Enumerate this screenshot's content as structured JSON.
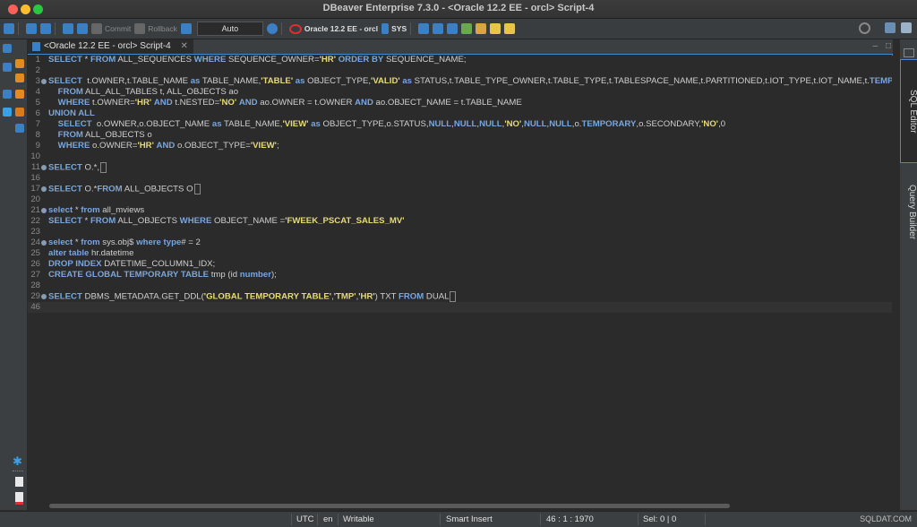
{
  "window": {
    "title": "DBeaver Enterprise 7.3.0 - <Oracle 12.2 EE - orcl> Script-4"
  },
  "toolbar": {
    "commit_label": "Commit",
    "rollback_label": "Rollback",
    "transaction_mode": "Auto",
    "connection_label": "Oracle 12.2 EE - orcl",
    "schema_label": "SYS"
  },
  "tab": {
    "label": "<Oracle 12.2 EE - orcl> Script-4"
  },
  "right_panel": {
    "sql_editor": "SQL Editor",
    "query_builder": "Query Builder"
  },
  "editor": {
    "lines": [
      {
        "n": "1",
        "fold": false,
        "tokens": [
          [
            "kw",
            "SELECT"
          ],
          [
            "p",
            " * "
          ],
          [
            "kw",
            "FROM"
          ],
          [
            "p",
            " ALL_SEQUENCES "
          ],
          [
            "kw",
            "WHERE"
          ],
          [
            "p",
            " SEQUENCE_OWNER="
          ],
          [
            "str",
            "'HR'"
          ],
          [
            "p",
            " "
          ],
          [
            "kw",
            "ORDER BY"
          ],
          [
            "p",
            " SEQUENCE_NAME;"
          ]
        ]
      },
      {
        "n": "2",
        "fold": false,
        "tokens": []
      },
      {
        "n": "3",
        "fold": true,
        "tokens": [
          [
            "kw",
            "SELECT"
          ],
          [
            "p",
            "  t.OWNER,t.TABLE_NAME "
          ],
          [
            "kw",
            "as"
          ],
          [
            "p",
            " TABLE_NAME,"
          ],
          [
            "str",
            "'TABLE'"
          ],
          [
            "p",
            " "
          ],
          [
            "kw",
            "as"
          ],
          [
            "p",
            " OBJECT_TYPE,"
          ],
          [
            "str",
            "'VALID'"
          ],
          [
            "p",
            " "
          ],
          [
            "kw",
            "as"
          ],
          [
            "p",
            " STATUS,t.TABLE_TYPE_OWNER,t.TABLE_TYPE,t.TABLESPACE_NAME,t.PARTITIONED,t.IOT_TYPE,t.IOT_NAME,t."
          ],
          [
            "kw",
            "TEMPO"
          ]
        ]
      },
      {
        "n": "4",
        "fold": false,
        "tokens": [
          [
            "p",
            "    "
          ],
          [
            "kw",
            "FROM"
          ],
          [
            "p",
            " ALL_ALL_TABLES t, ALL_OBJECTS ao"
          ]
        ]
      },
      {
        "n": "5",
        "fold": false,
        "tokens": [
          [
            "p",
            "    "
          ],
          [
            "kw",
            "WHERE"
          ],
          [
            "p",
            " t.OWNER="
          ],
          [
            "str",
            "'HR'"
          ],
          [
            "p",
            " "
          ],
          [
            "kw",
            "AND"
          ],
          [
            "p",
            " t.NESTED="
          ],
          [
            "str",
            "'NO'"
          ],
          [
            "p",
            " "
          ],
          [
            "kw",
            "AND"
          ],
          [
            "p",
            " ao.OWNER = t.OWNER "
          ],
          [
            "kw",
            "AND"
          ],
          [
            "p",
            " ao.OBJECT_NAME = t.TABLE_NAME"
          ]
        ]
      },
      {
        "n": "6",
        "fold": false,
        "tokens": [
          [
            "kw",
            "UNION ALL"
          ]
        ]
      },
      {
        "n": "7",
        "fold": false,
        "tokens": [
          [
            "p",
            "    "
          ],
          [
            "kw",
            "SELECT"
          ],
          [
            "p",
            "  o.OWNER,o.OBJECT_NAME "
          ],
          [
            "kw",
            "as"
          ],
          [
            "p",
            " TABLE_NAME,"
          ],
          [
            "str",
            "'VIEW'"
          ],
          [
            "p",
            " "
          ],
          [
            "kw",
            "as"
          ],
          [
            "p",
            " OBJECT_TYPE,o.STATUS,"
          ],
          [
            "kw",
            "NULL"
          ],
          [
            "p",
            ","
          ],
          [
            "kw",
            "NULL"
          ],
          [
            "p",
            ","
          ],
          [
            "kw",
            "NULL"
          ],
          [
            "p",
            ","
          ],
          [
            "str",
            "'NO'"
          ],
          [
            "p",
            ","
          ],
          [
            "kw",
            "NULL"
          ],
          [
            "p",
            ","
          ],
          [
            "kw",
            "NULL"
          ],
          [
            "p",
            ",o."
          ],
          [
            "kw",
            "TEMPORARY"
          ],
          [
            "p",
            ",o.SECONDARY,"
          ],
          [
            "str",
            "'NO'"
          ],
          [
            "p",
            ",0"
          ]
        ]
      },
      {
        "n": "8",
        "fold": false,
        "tokens": [
          [
            "p",
            "    "
          ],
          [
            "kw",
            "FROM"
          ],
          [
            "p",
            " ALL_OBJECTS o"
          ]
        ]
      },
      {
        "n": "9",
        "fold": false,
        "tokens": [
          [
            "p",
            "    "
          ],
          [
            "kw",
            "WHERE"
          ],
          [
            "p",
            " o.OWNER="
          ],
          [
            "str",
            "'HR'"
          ],
          [
            "p",
            " "
          ],
          [
            "kw",
            "AND"
          ],
          [
            "p",
            " o.OBJECT_TYPE="
          ],
          [
            "str",
            "'VIEW'"
          ],
          [
            "p",
            ";"
          ]
        ]
      },
      {
        "n": "10",
        "fold": false,
        "tokens": []
      },
      {
        "n": "11",
        "fold": true,
        "tokens": [
          [
            "kw",
            "SELECT"
          ],
          [
            "p",
            " O.*,"
          ],
          [
            "box",
            ""
          ]
        ]
      },
      {
        "n": "16",
        "fold": false,
        "tokens": []
      },
      {
        "n": "17",
        "fold": true,
        "tokens": [
          [
            "kw",
            "SELECT"
          ],
          [
            "p",
            " O.*"
          ],
          [
            "kw",
            "FROM"
          ],
          [
            "p",
            " ALL_OBJECTS O"
          ],
          [
            "box",
            ""
          ]
        ]
      },
      {
        "n": "20",
        "fold": false,
        "tokens": []
      },
      {
        "n": "21",
        "fold": true,
        "tokens": [
          [
            "kw",
            "select"
          ],
          [
            "p",
            " * "
          ],
          [
            "kw",
            "from"
          ],
          [
            "p",
            " all_mviews"
          ]
        ]
      },
      {
        "n": "22",
        "fold": false,
        "tokens": [
          [
            "kw",
            "SELECT"
          ],
          [
            "p",
            " * "
          ],
          [
            "kw",
            "FROM"
          ],
          [
            "p",
            " ALL_OBJECTS "
          ],
          [
            "kw",
            "WHERE"
          ],
          [
            "p",
            " OBJECT_NAME ="
          ],
          [
            "str",
            "'FWEEK_PSCAT_SALES_MV'"
          ]
        ]
      },
      {
        "n": "23",
        "fold": false,
        "tokens": []
      },
      {
        "n": "24",
        "fold": true,
        "tokens": [
          [
            "kw",
            "select"
          ],
          [
            "p",
            " * "
          ],
          [
            "kw",
            "from"
          ],
          [
            "p",
            " sys.obj$ "
          ],
          [
            "kw",
            "where"
          ],
          [
            "p",
            " "
          ],
          [
            "kw",
            "type"
          ],
          [
            "p",
            "# = 2"
          ]
        ]
      },
      {
        "n": "25",
        "fold": false,
        "tokens": [
          [
            "kw",
            "alter table"
          ],
          [
            "p",
            " hr.datetime"
          ]
        ]
      },
      {
        "n": "26",
        "fold": false,
        "tokens": [
          [
            "kw",
            "DROP INDEX"
          ],
          [
            "p",
            " DATETIME_COLUMN1_IDX;"
          ]
        ]
      },
      {
        "n": "27",
        "fold": false,
        "tokens": [
          [
            "kw",
            "CREATE GLOBAL TEMPORARY TABLE"
          ],
          [
            "p",
            " tmp (id "
          ],
          [
            "kw",
            "number"
          ],
          [
            "p",
            ");"
          ]
        ]
      },
      {
        "n": "28",
        "fold": false,
        "tokens": []
      },
      {
        "n": "29",
        "fold": true,
        "tokens": [
          [
            "kw",
            "SELECT"
          ],
          [
            "p",
            " DBMS_METADATA.GET_DDL("
          ],
          [
            "str",
            "'GLOBAL TEMPORARY TABLE'"
          ],
          [
            "p",
            ","
          ],
          [
            "str",
            "'TMP'"
          ],
          [
            "p",
            ","
          ],
          [
            "str",
            "'HR'"
          ],
          [
            "p",
            ") TXT "
          ],
          [
            "kw",
            "FROM"
          ],
          [
            "p",
            " DUAL"
          ],
          [
            "box",
            ""
          ]
        ]
      },
      {
        "n": "46",
        "fold": false,
        "tokens": [],
        "current": true
      }
    ]
  },
  "statusbar": {
    "timezone": "UTC",
    "locale": "en",
    "mode": "Writable",
    "insert_mode": "Smart Insert",
    "position": "46 : 1 : 1970",
    "selection": "Sel: 0 | 0"
  },
  "watermark": "SQLDAT.COM",
  "colors": {
    "keyword": "#7aa6da",
    "string": "#e6db74",
    "accent": "#4a88c7",
    "background": "#2b2b2b"
  }
}
